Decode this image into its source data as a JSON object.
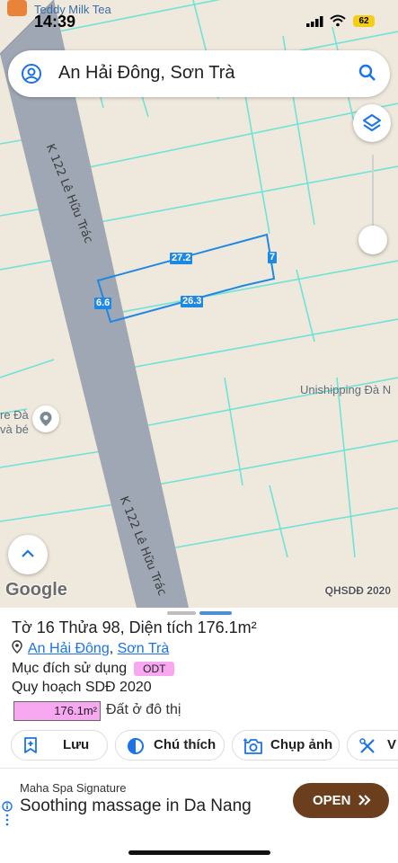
{
  "status_bar": {
    "app_name": "Teddy Milk Tea",
    "time": "14:39",
    "battery": "62"
  },
  "search": {
    "query": "An Hải Đông, Sơn Trà",
    "icons": {
      "left": "account-circle-icon",
      "right": "search-icon"
    }
  },
  "map": {
    "road_label_top": "K 122 Lê Hữu Trác",
    "road_label_bottom": "K 122 Lê Hữu Trác",
    "poi_right": "Unishipping Đà N",
    "poi_left_line1": "re Đà",
    "poi_left_line2": "và bé",
    "dimensions": {
      "top": "27.2",
      "right": "7",
      "left": "6.6",
      "bottom": "26.3"
    },
    "logo_text": "Google",
    "credit": "QHSDĐ 2020",
    "colors": {
      "parcel_outline": "#1e88e5",
      "lot_lines": "#6fe3d8",
      "road": "#9ea7b3",
      "background": "#efe8dc"
    }
  },
  "parcel": {
    "title": "Tờ 16 Thửa 98, Diện tích 176.1m²",
    "location_ward": "An Hải Đông",
    "location_separator": ", ",
    "location_district": "Sơn Trà",
    "purpose_label": "Mục đích sử dụng",
    "purpose_code": "ODT",
    "plan_label": "Quy hoạch SDĐ 2020",
    "area_value": "176.1m²",
    "area_description": "Đất ở đô thị",
    "tag_color": "#f7a8f0"
  },
  "actions": [
    {
      "label": "Lưu",
      "icon": "bookmark-add-icon"
    },
    {
      "label": "Chú thích",
      "icon": "contrast-icon"
    },
    {
      "label": "Chụp ảnh",
      "icon": "add-photo-icon"
    },
    {
      "label": "V",
      "icon": "tools-icon"
    }
  ],
  "ad": {
    "sponsor": "Maha Spa Signature",
    "headline": "Soothing massage in Da Nang",
    "cta": "OPEN",
    "cta_color": "#6b3f1e"
  }
}
